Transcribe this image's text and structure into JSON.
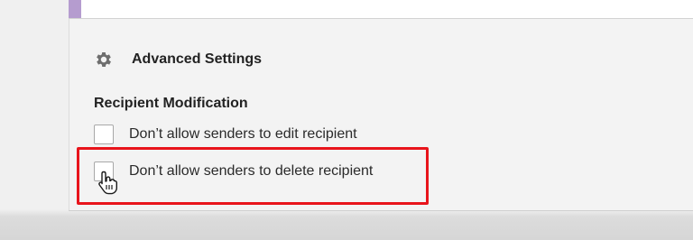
{
  "advanced_settings": {
    "title": "Advanced Settings",
    "icon": "gear-icon"
  },
  "recipient_modification": {
    "title": "Recipient Modification",
    "options": [
      {
        "label": "Don’t allow senders to edit recipient",
        "checked": false
      },
      {
        "label": "Don’t allow senders to delete recipient",
        "checked": false
      }
    ]
  },
  "highlight_color": "#e8141b",
  "accent_color": "#b59ccf"
}
